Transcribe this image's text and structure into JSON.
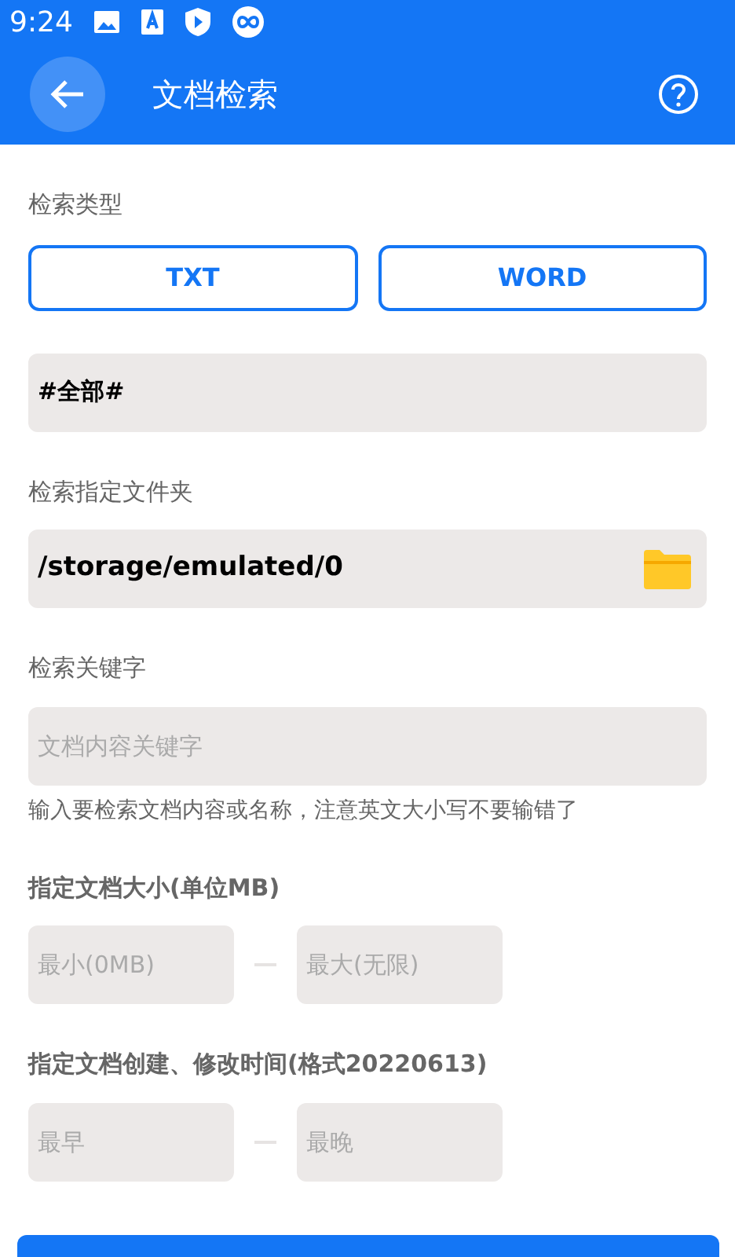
{
  "status_bar": {
    "time": "9:24"
  },
  "app_bar": {
    "title": "文档检索"
  },
  "type_section": {
    "label": "检索类型",
    "options": [
      {
        "label": "TXT",
        "selected": false
      },
      {
        "label": "WORD",
        "selected": false
      }
    ]
  },
  "category_field": {
    "value": "#全部#"
  },
  "folder_section": {
    "label": "检索指定文件夹",
    "value": "/storage/emulated/0"
  },
  "keyword_section": {
    "label": "检索关键字",
    "placeholder": "文档内容关键字",
    "hint": "输入要检索文档内容或名称，注意英文大小写不要输错了"
  },
  "size_section": {
    "label": "指定文档大小(单位MB)",
    "min_placeholder": "最小(0MB)",
    "max_placeholder": "最大(无限)"
  },
  "time_section": {
    "label": "指定文档创建、修改时间(格式20220613)",
    "min_placeholder": "最早",
    "max_placeholder": "最晚"
  }
}
